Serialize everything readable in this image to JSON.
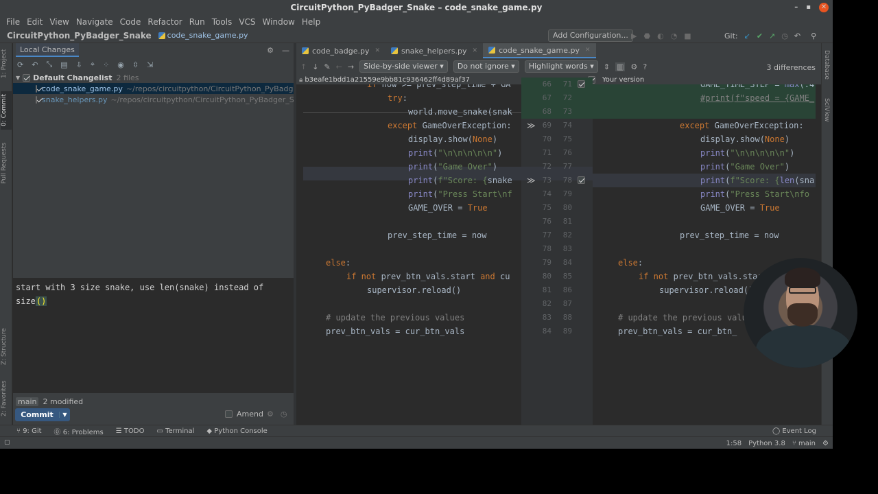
{
  "window": {
    "title": "CircuitPython_PyBadger_Snake – code_snake_game.py",
    "controls": [
      "–",
      "▪",
      "✕"
    ]
  },
  "menu": [
    "File",
    "Edit",
    "View",
    "Navigate",
    "Code",
    "Refactor",
    "Run",
    "Tools",
    "VCS",
    "Window",
    "Help"
  ],
  "navbar": {
    "project": "CircuitPython_PyBadger_Snake",
    "file": "code_snake_game.py",
    "add_configuration": "Add Configuration...",
    "git_label": "Git:"
  },
  "left_strip": {
    "tabs": [
      "1: Project",
      "0: Commit",
      "Pull Requests",
      "Z: Structure",
      "2: Favorites"
    ]
  },
  "right_strip": {
    "tabs": [
      "Database",
      "SciView"
    ]
  },
  "commit_panel": {
    "tab": "Local Changes",
    "changelist": {
      "name": "Default Changelist",
      "count": "2 files"
    },
    "files": [
      {
        "name": "code_snake_game.py",
        "path": "~/repos/circuitpython/CircuitPython_PyBadger_"
      },
      {
        "name": "snake_helpers.py",
        "path": "~/repos/circuitpython/CircuitPython_PyBadger_Sna"
      }
    ],
    "message_line1": "start with 3 size snake, use len(snake) instead of",
    "message_line2_a": "size",
    "message_line2_b": "()",
    "branch": "main",
    "modified": "2 modified",
    "commit_label": "Commit",
    "amend_label": "Amend"
  },
  "editor": {
    "tabs": [
      {
        "label": "code_badge.py",
        "active": false
      },
      {
        "label": "snake_helpers.py",
        "active": false
      },
      {
        "label": "code_snake_game.py",
        "active": true
      }
    ],
    "viewer_mode": "Side-by-side viewer",
    "ignore_mode": "Do not ignore",
    "highlight_mode": "Highlight words",
    "diff_count": "3 differences",
    "commit_hash": "b3eafe1bdd1a21559e9bb81c936462ff4d89af37",
    "your_version": "Your version"
  },
  "diff": {
    "left_lines": [
      {
        "ln": "66",
        "rn": "71"
      },
      {
        "ln": "67",
        "rn": "72"
      },
      {
        "ln": "68",
        "rn": "73"
      },
      {
        "ln": "69",
        "rn": "74"
      },
      {
        "ln": "70",
        "rn": "75"
      },
      {
        "ln": "71",
        "rn": "76"
      },
      {
        "ln": "72",
        "rn": "77"
      },
      {
        "ln": "73",
        "rn": "78"
      },
      {
        "ln": "74",
        "rn": "79"
      },
      {
        "ln": "75",
        "rn": "80"
      },
      {
        "ln": "76",
        "rn": "81"
      },
      {
        "ln": "77",
        "rn": "82"
      },
      {
        "ln": "78",
        "rn": "83"
      },
      {
        "ln": "79",
        "rn": "84"
      },
      {
        "ln": "80",
        "rn": "85"
      },
      {
        "ln": "81",
        "rn": "86"
      },
      {
        "ln": "82",
        "rn": "87"
      },
      {
        "ln": "83",
        "rn": "88"
      },
      {
        "ln": "84",
        "rn": "89"
      }
    ]
  },
  "bottom_tools": [
    "9: Git",
    "6: Problems",
    "TODO",
    "Terminal",
    "Python Console"
  ],
  "event_log": "Event Log",
  "status": {
    "position": "1:58",
    "interpreter": "Python 3.8",
    "branch": "main"
  },
  "colors": {
    "accent": "#4a88c7",
    "commit_button": "#365880",
    "added_bg": "#294436",
    "modified_bg": "#35383f"
  }
}
